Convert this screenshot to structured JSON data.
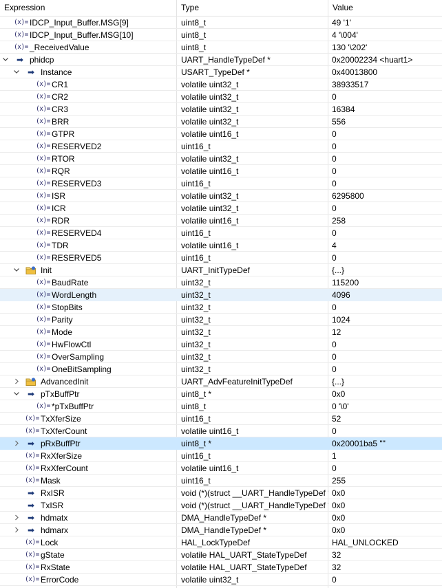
{
  "header": {
    "expression": "Expression",
    "type": "Type",
    "value": "Value"
  },
  "rows": [
    {
      "depth": 0,
      "twisty": "none",
      "icon": "var",
      "name": "IDCP_Input_Buffer.MSG[9]",
      "type": "uint8_t",
      "value": "49 '1'"
    },
    {
      "depth": 0,
      "twisty": "none",
      "icon": "var",
      "name": "IDCP_Input_Buffer.MSG[10]",
      "type": "uint8_t",
      "value": "4 '\\004'"
    },
    {
      "depth": 0,
      "twisty": "none",
      "icon": "var",
      "name": "_ReceivedValue",
      "type": "uint8_t",
      "value": "130 '\\202'"
    },
    {
      "depth": 0,
      "twisty": "expanded",
      "icon": "ptr",
      "name": "phidcp",
      "type": "UART_HandleTypeDef *",
      "value": "0x20002234 <huart1>"
    },
    {
      "depth": 1,
      "twisty": "expanded",
      "icon": "ptr",
      "name": "Instance",
      "type": "USART_TypeDef *",
      "value": "0x40013800"
    },
    {
      "depth": 2,
      "twisty": "none",
      "icon": "var",
      "name": "CR1",
      "type": "volatile uint32_t",
      "value": "38933517"
    },
    {
      "depth": 2,
      "twisty": "none",
      "icon": "var",
      "name": "CR2",
      "type": "volatile uint32_t",
      "value": "0"
    },
    {
      "depth": 2,
      "twisty": "none",
      "icon": "var",
      "name": "CR3",
      "type": "volatile uint32_t",
      "value": "16384"
    },
    {
      "depth": 2,
      "twisty": "none",
      "icon": "var",
      "name": "BRR",
      "type": "volatile uint32_t",
      "value": "556"
    },
    {
      "depth": 2,
      "twisty": "none",
      "icon": "var",
      "name": "GTPR",
      "type": "volatile uint16_t",
      "value": "0"
    },
    {
      "depth": 2,
      "twisty": "none",
      "icon": "var",
      "name": "RESERVED2",
      "type": "uint16_t",
      "value": "0"
    },
    {
      "depth": 2,
      "twisty": "none",
      "icon": "var",
      "name": "RTOR",
      "type": "volatile uint32_t",
      "value": "0"
    },
    {
      "depth": 2,
      "twisty": "none",
      "icon": "var",
      "name": "RQR",
      "type": "volatile uint16_t",
      "value": "0"
    },
    {
      "depth": 2,
      "twisty": "none",
      "icon": "var",
      "name": "RESERVED3",
      "type": "uint16_t",
      "value": "0"
    },
    {
      "depth": 2,
      "twisty": "none",
      "icon": "var",
      "name": "ISR",
      "type": "volatile uint32_t",
      "value": "6295800"
    },
    {
      "depth": 2,
      "twisty": "none",
      "icon": "var",
      "name": "ICR",
      "type": "volatile uint32_t",
      "value": "0"
    },
    {
      "depth": 2,
      "twisty": "none",
      "icon": "var",
      "name": "RDR",
      "type": "volatile uint16_t",
      "value": "258"
    },
    {
      "depth": 2,
      "twisty": "none",
      "icon": "var",
      "name": "RESERVED4",
      "type": "uint16_t",
      "value": "0"
    },
    {
      "depth": 2,
      "twisty": "none",
      "icon": "var",
      "name": "TDR",
      "type": "volatile uint16_t",
      "value": "4"
    },
    {
      "depth": 2,
      "twisty": "none",
      "icon": "var",
      "name": "RESERVED5",
      "type": "uint16_t",
      "value": "0"
    },
    {
      "depth": 1,
      "twisty": "expanded",
      "icon": "struct",
      "name": "Init",
      "type": "UART_InitTypeDef",
      "value": "{...}"
    },
    {
      "depth": 2,
      "twisty": "none",
      "icon": "var",
      "name": "BaudRate",
      "type": "uint32_t",
      "value": "115200"
    },
    {
      "depth": 2,
      "twisty": "none",
      "icon": "var",
      "name": "WordLength",
      "type": "uint32_t",
      "value": "4096",
      "state": "highlight"
    },
    {
      "depth": 2,
      "twisty": "none",
      "icon": "var",
      "name": "StopBits",
      "type": "uint32_t",
      "value": "0"
    },
    {
      "depth": 2,
      "twisty": "none",
      "icon": "var",
      "name": "Parity",
      "type": "uint32_t",
      "value": "1024"
    },
    {
      "depth": 2,
      "twisty": "none",
      "icon": "var",
      "name": "Mode",
      "type": "uint32_t",
      "value": "12"
    },
    {
      "depth": 2,
      "twisty": "none",
      "icon": "var",
      "name": "HwFlowCtl",
      "type": "uint32_t",
      "value": "0"
    },
    {
      "depth": 2,
      "twisty": "none",
      "icon": "var",
      "name": "OverSampling",
      "type": "uint32_t",
      "value": "0"
    },
    {
      "depth": 2,
      "twisty": "none",
      "icon": "var",
      "name": "OneBitSampling",
      "type": "uint32_t",
      "value": "0"
    },
    {
      "depth": 1,
      "twisty": "collapsed",
      "icon": "struct",
      "name": "AdvancedInit",
      "type": "UART_AdvFeatureInitTypeDef",
      "value": "{...}"
    },
    {
      "depth": 1,
      "twisty": "expanded",
      "icon": "ptr",
      "name": "pTxBuffPtr",
      "type": "uint8_t *",
      "value": "0x0"
    },
    {
      "depth": 2,
      "twisty": "none",
      "icon": "var",
      "name": "*pTxBuffPtr",
      "type": "uint8_t",
      "value": "0 '\\0'"
    },
    {
      "depth": 1,
      "twisty": "none",
      "icon": "var",
      "name": "TxXferSize",
      "type": "uint16_t",
      "value": "52"
    },
    {
      "depth": 1,
      "twisty": "none",
      "icon": "var",
      "name": "TxXferCount",
      "type": "volatile uint16_t",
      "value": "0"
    },
    {
      "depth": 1,
      "twisty": "collapsed",
      "icon": "ptr",
      "name": "pRxBuffPtr",
      "type": "uint8_t *",
      "value": "0x20001ba5 \"\"",
      "state": "selected"
    },
    {
      "depth": 1,
      "twisty": "none",
      "icon": "var",
      "name": "RxXferSize",
      "type": "uint16_t",
      "value": "1"
    },
    {
      "depth": 1,
      "twisty": "none",
      "icon": "var",
      "name": "RxXferCount",
      "type": "volatile uint16_t",
      "value": "0"
    },
    {
      "depth": 1,
      "twisty": "none",
      "icon": "var",
      "name": "Mask",
      "type": "uint16_t",
      "value": "255"
    },
    {
      "depth": 1,
      "twisty": "none",
      "icon": "ptr",
      "name": "RxISR",
      "type": "void (*)(struct __UART_HandleTypeDef *)",
      "value": "0x0"
    },
    {
      "depth": 1,
      "twisty": "none",
      "icon": "ptr",
      "name": "TxISR",
      "type": "void (*)(struct __UART_HandleTypeDef *)",
      "value": "0x0"
    },
    {
      "depth": 1,
      "twisty": "collapsed",
      "icon": "ptr",
      "name": "hdmatx",
      "type": "DMA_HandleTypeDef *",
      "value": "0x0"
    },
    {
      "depth": 1,
      "twisty": "collapsed",
      "icon": "ptr",
      "name": "hdmarx",
      "type": "DMA_HandleTypeDef *",
      "value": "0x0"
    },
    {
      "depth": 1,
      "twisty": "none",
      "icon": "var",
      "name": "Lock",
      "type": "HAL_LockTypeDef",
      "value": "HAL_UNLOCKED"
    },
    {
      "depth": 1,
      "twisty": "none",
      "icon": "var",
      "name": "gState",
      "type": "volatile HAL_UART_StateTypeDef",
      "value": "32"
    },
    {
      "depth": 1,
      "twisty": "none",
      "icon": "var",
      "name": "RxState",
      "type": "volatile HAL_UART_StateTypeDef",
      "value": "32"
    },
    {
      "depth": 1,
      "twisty": "none",
      "icon": "var",
      "name": "ErrorCode",
      "type": "volatile uint32_t",
      "value": "0"
    }
  ],
  "icons": {
    "var": {
      "name": "variable-icon",
      "glyph": "(x)="
    },
    "ptr": {
      "name": "pointer-arrow-icon",
      "glyph": "➡"
    },
    "struct": {
      "name": "struct-folder-icon",
      "glyph": ""
    }
  },
  "colors": {
    "selected_row": "#cce8ff",
    "hover_row": "#e5f1fb",
    "grid_line": "#ececec",
    "icon_blue": "#1e3a78",
    "folder_yellow": "#e8c04a"
  }
}
